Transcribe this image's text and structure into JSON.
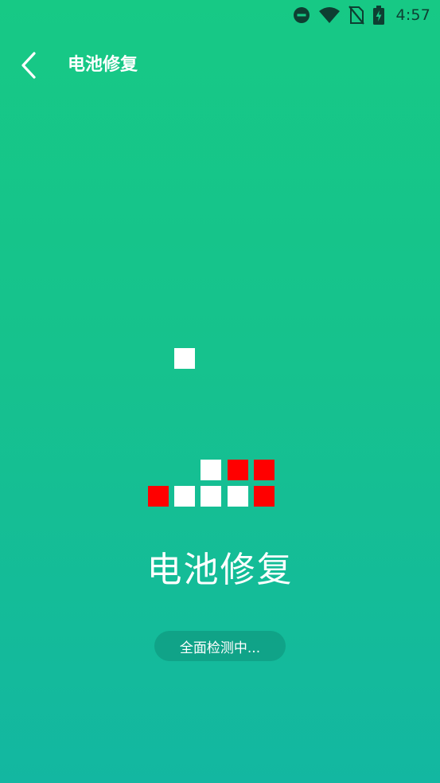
{
  "status_bar": {
    "time": "4:57",
    "icons": [
      "do-not-disturb-icon",
      "wifi-icon",
      "no-sim-icon",
      "battery-charging-icon"
    ]
  },
  "app_bar": {
    "back_icon": "chevron-left-icon",
    "title": "电池修复"
  },
  "main": {
    "title": "电池修复",
    "status_text": "全面检测中..."
  },
  "blocks": {
    "colors": {
      "white": "#ffffff",
      "red": "#ff0000",
      "background_top": "#17c985",
      "background_bottom": "#13b7a1"
    }
  }
}
